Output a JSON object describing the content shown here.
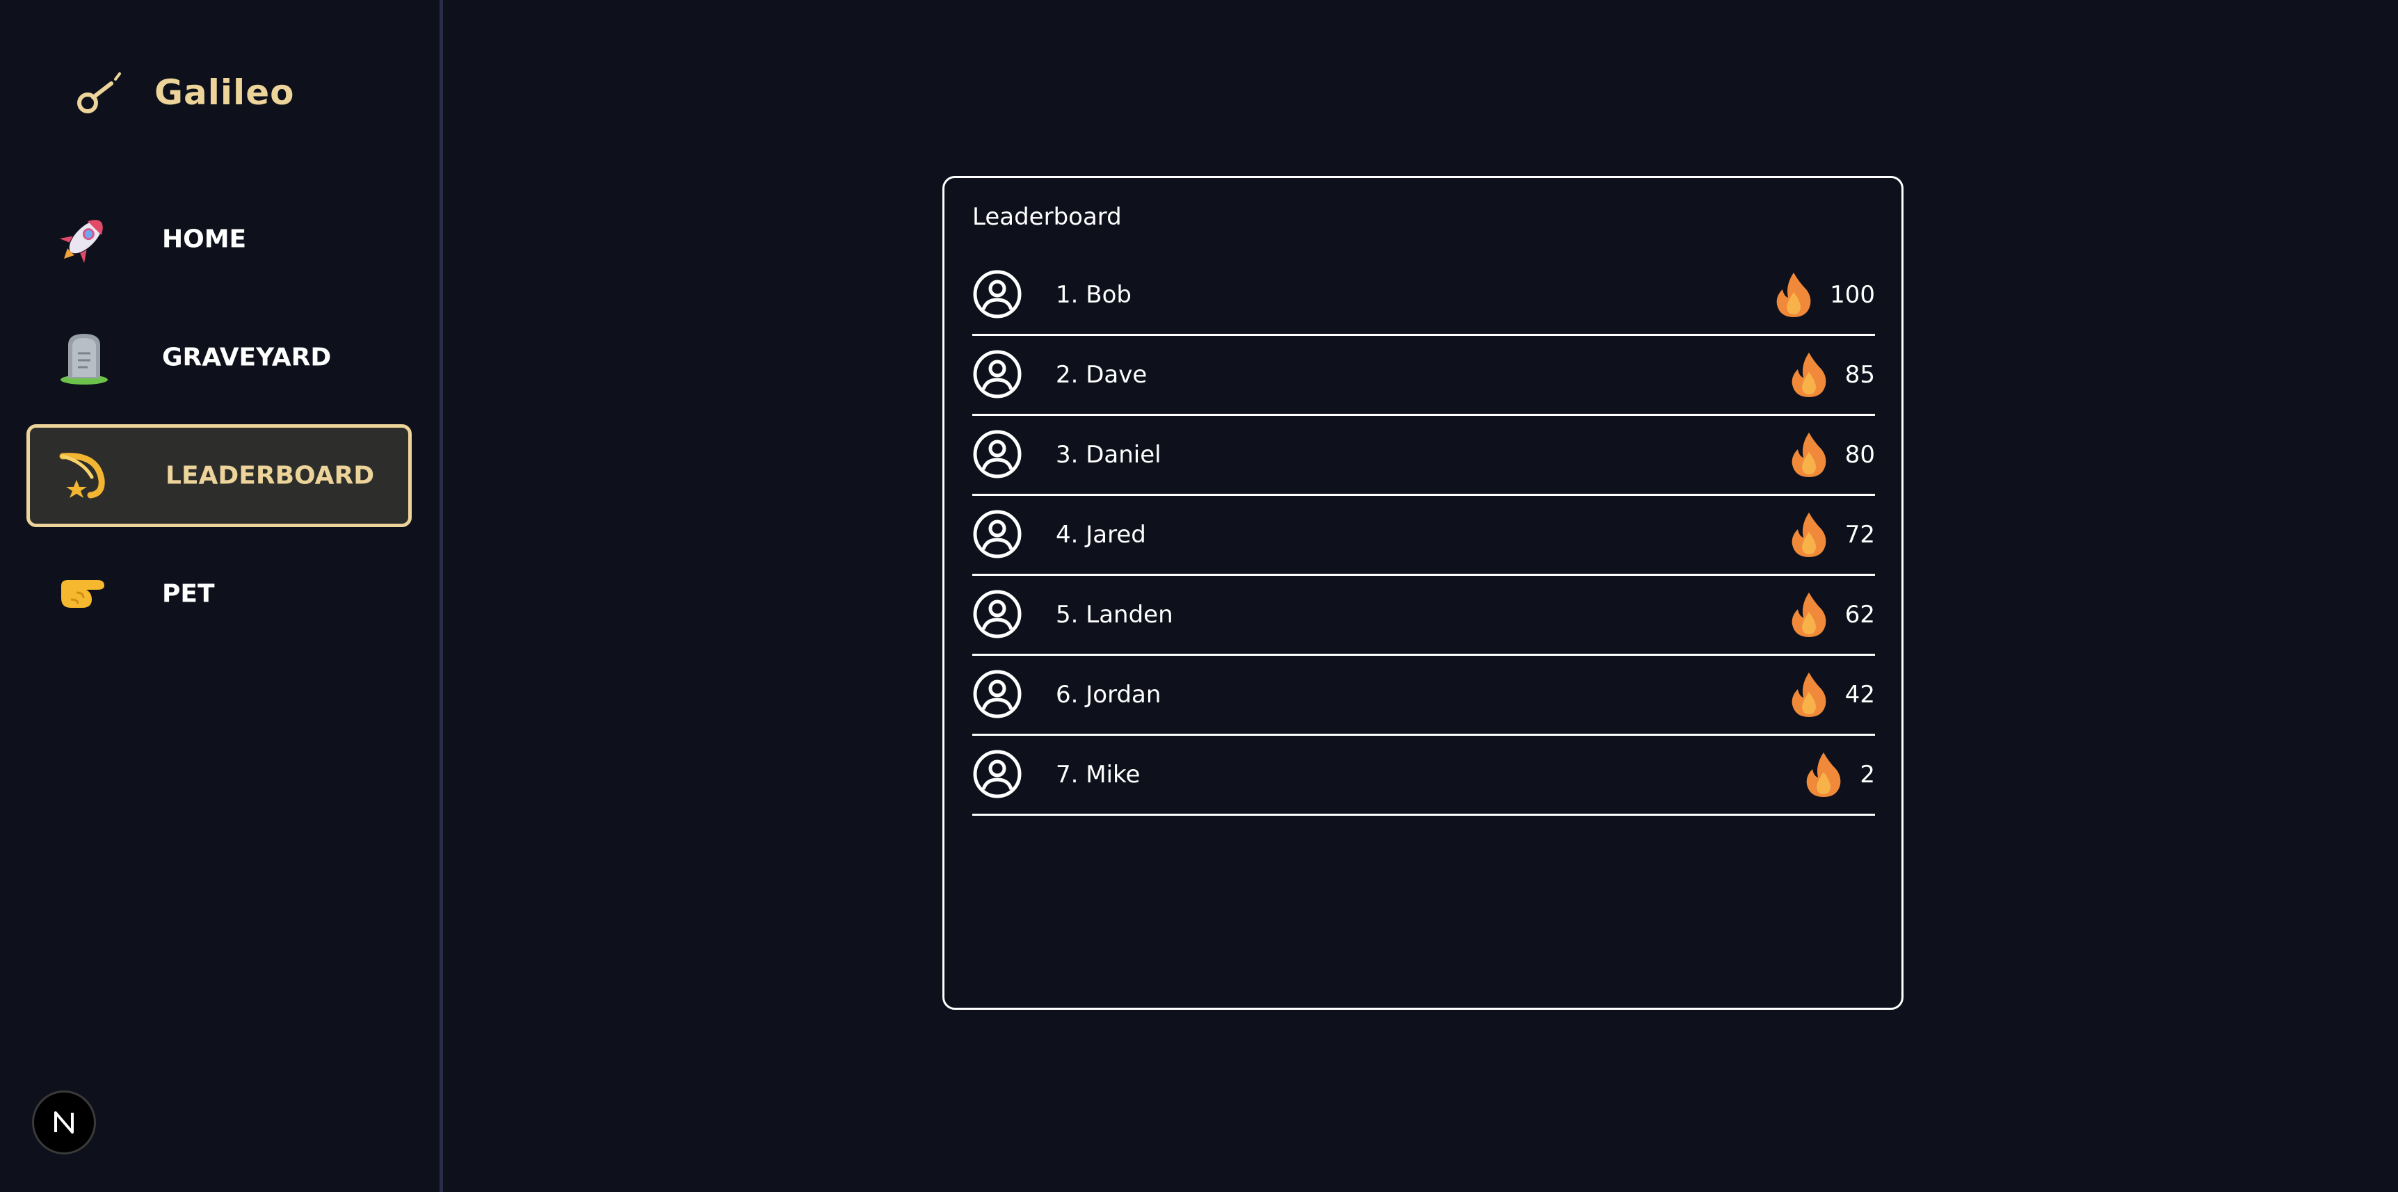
{
  "brand": {
    "name": "Galileo",
    "color": "#ecd49a"
  },
  "nav": {
    "items": [
      {
        "label": "HOME",
        "icon": "rocket-icon",
        "active": false
      },
      {
        "label": "GRAVEYARD",
        "icon": "headstone-icon",
        "active": false
      },
      {
        "label": "LEADERBOARD",
        "icon": "comet-icon",
        "active": true
      },
      {
        "label": "PET",
        "icon": "pointing-hand-icon",
        "active": false
      }
    ]
  },
  "footer_badge": {
    "label": "N"
  },
  "leaderboard": {
    "title": "Leaderboard",
    "entries": [
      {
        "name": "1. Bob",
        "score": "100"
      },
      {
        "name": "2. Dave",
        "score": "85"
      },
      {
        "name": "3. Daniel",
        "score": "80"
      },
      {
        "name": "4. Jared",
        "score": "72"
      },
      {
        "name": "5. Landen",
        "score": "62"
      },
      {
        "name": "6. Jordan",
        "score": "42"
      },
      {
        "name": "7. Mike",
        "score": "2"
      }
    ]
  }
}
